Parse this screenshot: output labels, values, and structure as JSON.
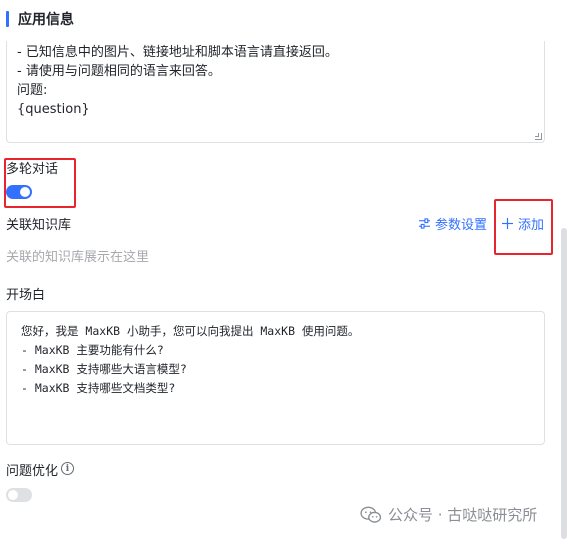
{
  "section": {
    "title": "应用信息"
  },
  "prompt": {
    "lines": [
      "- 已知信息中的图片、链接地址和脚本语言请直接返回。",
      "- 请使用与问题相同的语言来回答。",
      "问题:",
      "{question}"
    ]
  },
  "multi_turn": {
    "label": "多轮对话",
    "enabled": true
  },
  "knowledge": {
    "label": "关联知识库",
    "param_settings_label": "参数设置",
    "add_label": "添加",
    "placeholder": "关联的知识库展示在这里"
  },
  "prologue": {
    "label": "开场白",
    "lines": [
      "您好，我是 MaxKB 小助手，您可以向我提出 MaxKB 使用问题。",
      "- MaxKB 主要功能有什么?",
      "- MaxKB 支持哪些大语言模型?",
      "- MaxKB 支持哪些文档类型?"
    ]
  },
  "problem_optimization": {
    "label": "问题优化",
    "enabled": false
  },
  "watermark": {
    "text": "公众号 · 古哒哒研究所"
  },
  "icons": {
    "settings": "sliders-icon",
    "add": "plus-icon",
    "info": "info-icon",
    "wechat": "wechat-icon"
  },
  "colors": {
    "accent": "#3370ff",
    "highlight": "#e8242c",
    "muted": "#a6a9ad",
    "border": "#dee0e3"
  }
}
